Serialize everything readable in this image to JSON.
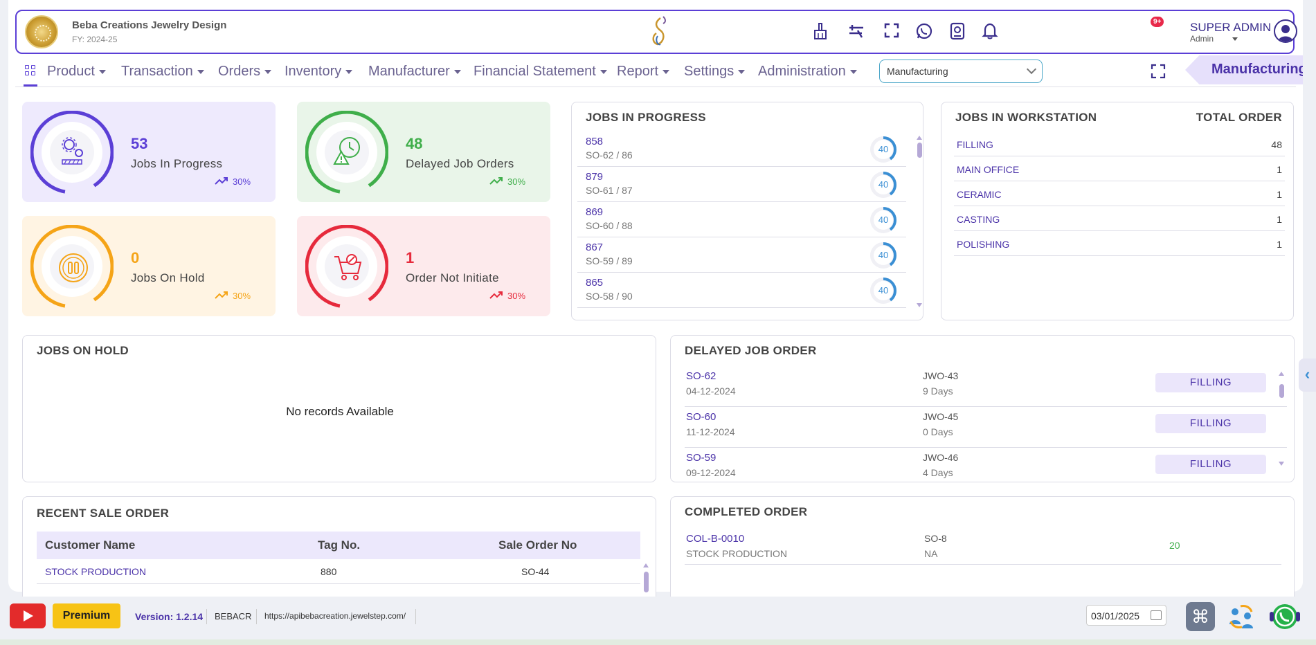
{
  "header": {
    "company": "Beba Creations Jewelry Design",
    "fy": "FY: 2024-25",
    "notification_badge": "9+",
    "user_name": "SUPER ADMIN",
    "user_role": "Admin"
  },
  "nav": {
    "items": [
      "Product",
      "Transaction",
      "Orders",
      "Inventory",
      "Manufacturer",
      "Financial Statement",
      "Report",
      "Settings",
      "Administration"
    ],
    "select_value": "Manufacturing",
    "module_tag": "Manufacturing"
  },
  "stats": {
    "in_progress": {
      "value": "53",
      "label": "Jobs In Progress",
      "trend": "30%",
      "color": "#5b3fd6",
      "bg": "#eeeafd"
    },
    "delayed": {
      "value": "48",
      "label": "Delayed Job Orders",
      "trend": "30%",
      "color": "#3fae4a",
      "bg": "#e9f5e9"
    },
    "on_hold": {
      "value": "0",
      "label": "Jobs On Hold",
      "trend": "30%",
      "color": "#f5a417",
      "bg": "#fff4e3"
    },
    "not_initiate": {
      "value": "1",
      "label": "Order Not Initiate",
      "trend": "30%",
      "color": "#e62a3c",
      "bg": "#fdeaec"
    }
  },
  "jobs_in_progress": {
    "title": "JOBS IN PROGRESS",
    "rows": [
      {
        "id": "858",
        "so": "SO-62 / 86",
        "pct": "40"
      },
      {
        "id": "879",
        "so": "SO-61 / 87",
        "pct": "40"
      },
      {
        "id": "869",
        "so": "SO-60 / 88",
        "pct": "40"
      },
      {
        "id": "867",
        "so": "SO-59 / 89",
        "pct": "40"
      },
      {
        "id": "865",
        "so": "SO-58 / 90",
        "pct": "40"
      }
    ]
  },
  "workstation": {
    "title": "JOBS IN WORKSTATION",
    "total_label": "TOTAL ORDER",
    "rows": [
      {
        "name": "FILLING",
        "total": "48"
      },
      {
        "name": "MAIN OFFICE",
        "total": "1"
      },
      {
        "name": "CERAMIC",
        "total": "1"
      },
      {
        "name": "CASTING",
        "total": "1"
      },
      {
        "name": "POLISHING",
        "total": "1"
      }
    ]
  },
  "jobs_on_hold": {
    "title": "JOBS ON HOLD",
    "empty": "No records Available"
  },
  "delayed_job_order": {
    "title": "DELAYED JOB ORDER",
    "rows": [
      {
        "so": "SO-62",
        "date": "04-12-2024",
        "jwo": "JWO-43",
        "days": "9 Days",
        "station": "FILLING"
      },
      {
        "so": "SO-60",
        "date": "11-12-2024",
        "jwo": "JWO-45",
        "days": "0 Days",
        "station": "FILLING"
      },
      {
        "so": "SO-59",
        "date": "09-12-2024",
        "jwo": "JWO-46",
        "days": "4 Days",
        "station": "FILLING"
      }
    ]
  },
  "recent_sale_order": {
    "title": "RECENT SALE ORDER",
    "columns": [
      "Customer Name",
      "Tag No.",
      "Sale Order No"
    ],
    "rows": [
      {
        "customer": "STOCK PRODUCTION",
        "tag": "880",
        "so": "SO-44"
      }
    ]
  },
  "completed_order": {
    "title": "COMPLETED ORDER",
    "rows": [
      {
        "code": "COL-B-0010",
        "customer": "STOCK PRODUCTION",
        "so": "SO-8",
        "na": "NA",
        "qty": "20"
      }
    ]
  },
  "footer": {
    "premium": "Premium",
    "version": "Version: 1.2.14",
    "code": "BEBACR",
    "url": "https://apibebacreation.jewelstep.com/",
    "date": "03/01/2025"
  }
}
